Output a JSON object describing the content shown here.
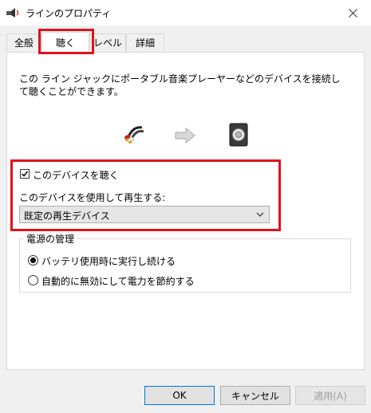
{
  "window": {
    "title": "ラインのプロパティ"
  },
  "tabs": [
    {
      "label": "全般"
    },
    {
      "label": "聴く"
    },
    {
      "label": "レベル"
    },
    {
      "label": "詳細"
    }
  ],
  "listen_tab": {
    "description": "この ライン ジャックにポータブル音楽プレーヤーなどのデバイスを接続して聴くことができます。",
    "listen_checkbox": {
      "label": "このデバイスを聴く",
      "checked": true
    },
    "playback_label": "このデバイスを使用して再生する:",
    "playback_select": {
      "value": "既定の再生デバイス"
    },
    "power_group": {
      "title": "電源の管理",
      "options": [
        {
          "label": "バッテリ使用時に実行し続ける",
          "selected": true
        },
        {
          "label": "自動的に無効にして電力を節約する",
          "selected": false
        }
      ]
    }
  },
  "buttons": {
    "ok": "OK",
    "cancel": "キャンセル",
    "apply": "適用(A)"
  },
  "icons": [
    "speaker-app-icon",
    "close-icon",
    "audio-cable-icon",
    "arrow-right-icon",
    "speaker-icon",
    "checkmark-icon",
    "chevron-down-icon"
  ],
  "colors": {
    "highlight": "#e0121b",
    "accent": "#0078d7"
  }
}
